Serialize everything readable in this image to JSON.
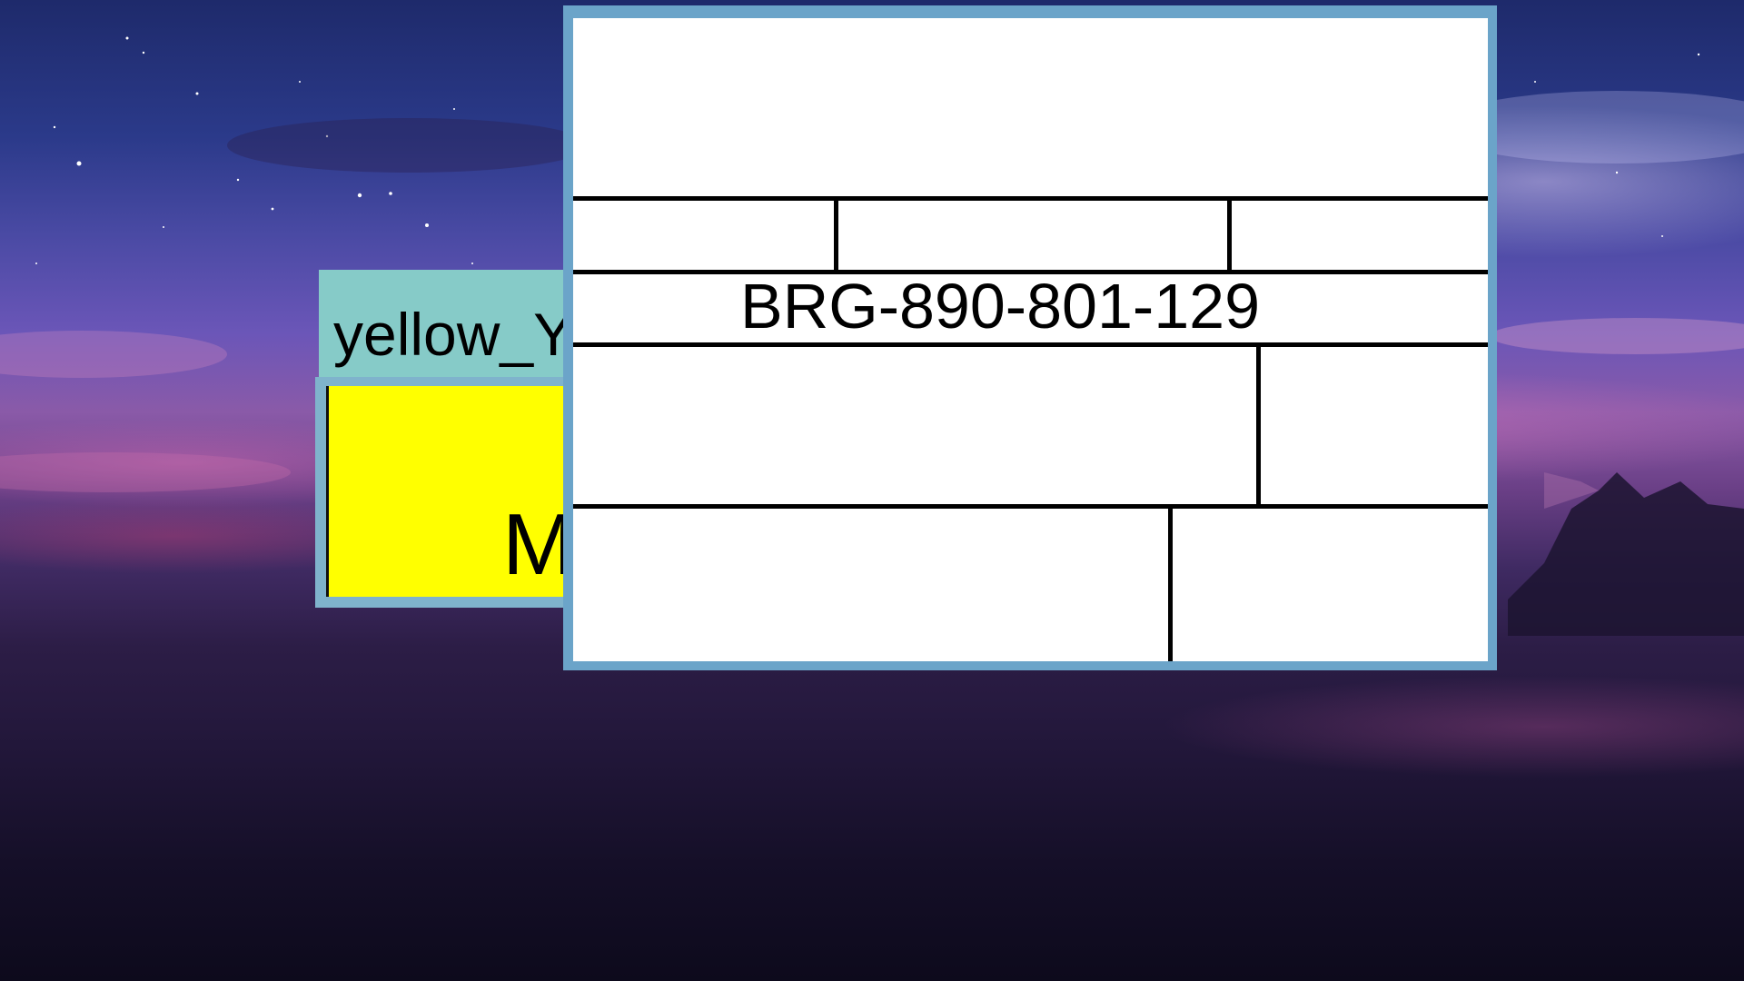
{
  "desktop": {
    "wallpaper": "night sky over clouds and mountains"
  },
  "back_window": {
    "title": "yellow_Y",
    "visible_letter": "M",
    "title_color": "#86cbc8",
    "body_color": "#ffff00"
  },
  "front_window": {
    "frame_color": "#6ba4c9",
    "title_partial": "_      _",
    "code": "BRG-890-801-129"
  }
}
